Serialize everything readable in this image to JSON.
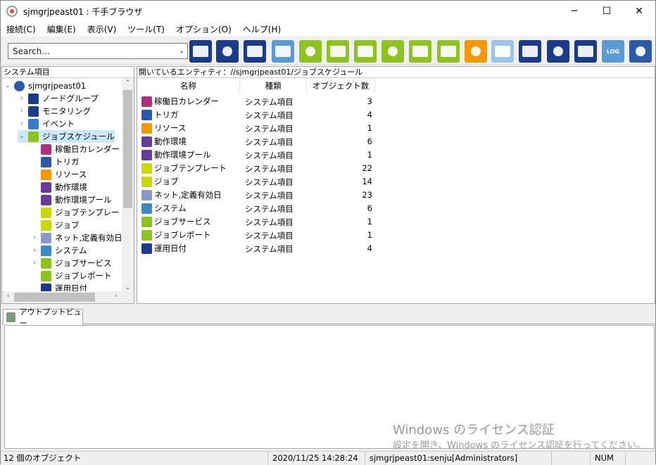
{
  "window": {
    "title": "sjmgrjpeast01 : 千手ブラウザ",
    "controls": [
      "minimize-icon",
      "maximize-icon",
      "close-icon"
    ]
  },
  "menu": [
    "接続(C)",
    "編集(E)",
    "表示(V)",
    "ツール(T)",
    "オプション(O)",
    "ヘルプ(H)"
  ],
  "search": {
    "value": "Search..."
  },
  "toolbar": {
    "buttons": [
      {
        "name": "node-group-icon",
        "color": "#1a3a8a"
      },
      {
        "name": "monitor-icon",
        "color": "#1a3a8a"
      },
      {
        "name": "monitor-stack-icon",
        "color": "#1a3a8a"
      },
      {
        "name": "message-icon",
        "color": "#5b9bd5"
      },
      {
        "name": "gear-green-icon",
        "color": "#8dc21f"
      },
      {
        "name": "check-green-icon",
        "color": "#8dc21f"
      },
      {
        "name": "puzzle-green-icon",
        "color": "#8dc21f"
      },
      {
        "name": "screen-check-icon",
        "color": "#8dc21f"
      },
      {
        "name": "report-green-icon",
        "color": "#8dc21f"
      },
      {
        "name": "list-green-icon",
        "color": "#8dc21f"
      },
      {
        "name": "chart-orange-icon",
        "color": "#f39800"
      },
      {
        "name": "network-disabled-icon",
        "color": "#9cc6e6"
      },
      {
        "name": "gear-arrow-icon",
        "color": "#1a3a8a"
      },
      {
        "name": "check-arrow-icon",
        "color": "#1a3a8a"
      },
      {
        "name": "monitor-arrow-icon",
        "color": "#1a3a8a"
      },
      {
        "name": "log-icon",
        "color": "#5b9bd5",
        "label": "LOG"
      },
      {
        "name": "radar-icon",
        "color": "#2a5aa8"
      }
    ]
  },
  "tree": {
    "header": "システム項目",
    "root": "sjmgrjpeast01",
    "items": [
      {
        "label": "ノードグループ",
        "level": 1,
        "expand": "›",
        "icon": "#1a3a8a"
      },
      {
        "label": "モニタリング",
        "level": 1,
        "expand": "›",
        "icon": "#1a3a8a"
      },
      {
        "label": "イベント",
        "level": 1,
        "expand": "›",
        "icon": "#3a7ac8"
      },
      {
        "label": "ジョブスケジュール",
        "level": 1,
        "expand": "⌄",
        "icon": "#8dc21f",
        "selected": true
      },
      {
        "label": "稼働日カレンダー",
        "level": 2,
        "expand": "",
        "icon": "#b03080"
      },
      {
        "label": "トリガ",
        "level": 2,
        "expand": "",
        "icon": "#2a5aa8"
      },
      {
        "label": "リソース",
        "level": 2,
        "expand": "",
        "icon": "#f39800"
      },
      {
        "label": "動作環境",
        "level": 2,
        "expand": "",
        "icon": "#6a3a9a"
      },
      {
        "label": "動作環境プール",
        "level": 2,
        "expand": "",
        "icon": "#6a3a9a"
      },
      {
        "label": "ジョブテンプレート",
        "level": 2,
        "expand": "",
        "icon": "#c8d800"
      },
      {
        "label": "ジョブ",
        "level": 2,
        "expand": "",
        "icon": "#c8d800"
      },
      {
        "label": "ネット,定義有効日",
        "level": 2,
        "expand": "›",
        "icon": "#8a9ac8"
      },
      {
        "label": "システム",
        "level": 2,
        "expand": "›",
        "icon": "#3a8ac8"
      },
      {
        "label": "ジョブサービス",
        "level": 2,
        "expand": "›",
        "icon": "#8dc21f"
      },
      {
        "label": "ジョブレポート",
        "level": 2,
        "expand": "",
        "icon": "#8dc21f"
      },
      {
        "label": "運用日付",
        "level": 2,
        "expand": "",
        "icon": "#1a3a8a"
      }
    ]
  },
  "list": {
    "path": "開いているエンティティ：//sjmgrjpeast01/ジョブスケジュール",
    "columns": [
      "名称",
      "種類",
      "オブジェクト数"
    ],
    "rows": [
      {
        "name": "稼働日カレンダー",
        "type": "システム項目",
        "count": "3",
        "icon": "#b03080"
      },
      {
        "name": "トリガ",
        "type": "システム項目",
        "count": "4",
        "icon": "#2a5aa8"
      },
      {
        "name": "リソース",
        "type": "システム項目",
        "count": "1",
        "icon": "#f39800"
      },
      {
        "name": "動作環境",
        "type": "システム項目",
        "count": "6",
        "icon": "#6a3a9a"
      },
      {
        "name": "動作環境プール",
        "type": "システム項目",
        "count": "1",
        "icon": "#6a3a9a"
      },
      {
        "name": "ジョブテンプレート",
        "type": "システム項目",
        "count": "22",
        "icon": "#c8d800"
      },
      {
        "name": "ジョブ",
        "type": "システム項目",
        "count": "14",
        "icon": "#c8d800"
      },
      {
        "name": "ネット,定義有効日",
        "type": "システム項目",
        "count": "23",
        "icon": "#8a9ac8"
      },
      {
        "name": "システム",
        "type": "システム項目",
        "count": "6",
        "icon": "#3a8ac8"
      },
      {
        "name": "ジョブサービス",
        "type": "システム項目",
        "count": "1",
        "icon": "#8dc21f"
      },
      {
        "name": "ジョブレポート",
        "type": "システム項目",
        "count": "1",
        "icon": "#8dc21f"
      },
      {
        "name": "運用日付",
        "type": "システム項目",
        "count": "4",
        "icon": "#1a3a8a"
      }
    ]
  },
  "output": {
    "tab": "アウトプットビュー"
  },
  "watermark": {
    "line1": "Windows のライセンス認証",
    "line2": "設定を開き、Windows のライセンス認証を行ってください。"
  },
  "status": {
    "objects": "12 個のオブジェクト",
    "datetime": "2020/11/25 14:28:24",
    "user": "sjmgrjpeast01:senju[Administrators]",
    "num": "NUM"
  }
}
